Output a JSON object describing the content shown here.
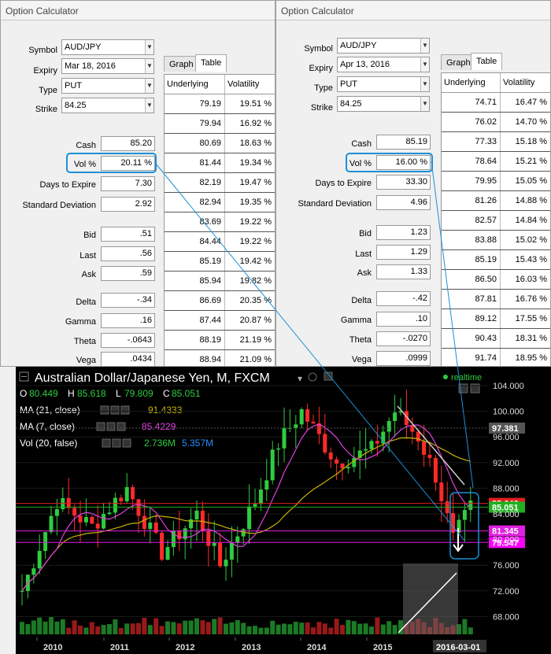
{
  "calc1": {
    "title": "Option Calculator",
    "symbol": "AUD/JPY",
    "expiry": "Mar 18, 2016",
    "type": "PUT",
    "strike": "84.25",
    "labels": {
      "symbol": "Symbol",
      "expiry": "Expiry",
      "type": "Type",
      "strike": "Strike",
      "cash": "Cash",
      "vol": "Vol %",
      "days": "Days to Expire",
      "std": "Standard Deviation",
      "bid": "Bid",
      "last": "Last",
      "ask": "Ask",
      "delta": "Delta",
      "gamma": "Gamma",
      "theta": "Theta",
      "vega": "Vega"
    },
    "cash": "85.20",
    "vol": "20.11 %",
    "days": "7.30",
    "std": "2.92",
    "bid": ".51",
    "last": ".56",
    "ask": ".59",
    "delta": "-.34",
    "gamma": ".16",
    "theta": "-.0643",
    "vega": ".0434",
    "tab_graph": "Graph",
    "tab_table": "Table",
    "col_underlying": "Underlying",
    "col_volatility": "Volatility",
    "rows": [
      [
        "79.19",
        "19.51 %"
      ],
      [
        "79.94",
        "16.92 %"
      ],
      [
        "80.69",
        "18.63 %"
      ],
      [
        "81.44",
        "19.34 %"
      ],
      [
        "82.19",
        "19.47 %"
      ],
      [
        "82.94",
        "19.35 %"
      ],
      [
        "83.69",
        "19.22 %"
      ],
      [
        "84.44",
        "19.22 %"
      ],
      [
        "85.19",
        "19.42 %"
      ],
      [
        "85.94",
        "19.82 %"
      ],
      [
        "86.69",
        "20.35 %"
      ],
      [
        "87.44",
        "20.87 %"
      ],
      [
        "88.19",
        "21.19 %"
      ],
      [
        "88.94",
        "21.09 %"
      ]
    ]
  },
  "calc2": {
    "title": "Option Calculator",
    "symbol": "AUD/JPY",
    "expiry": "Apr 13, 2016",
    "type": "PUT",
    "strike": "84.25",
    "labels": {
      "symbol": "Symbol",
      "expiry": "Expiry",
      "type": "Type",
      "strike": "Strike",
      "cash": "Cash",
      "vol": "Vol %",
      "days": "Days to Expire",
      "std": "Standard Deviation",
      "bid": "Bid",
      "last": "Last",
      "ask": "Ask",
      "delta": "Delta",
      "gamma": "Gamma",
      "theta": "Theta",
      "vega": "Vega"
    },
    "cash": "85.19",
    "vol": "16.00 %",
    "days": "33.30",
    "std": "4.96",
    "bid": "1.23",
    "last": "1.29",
    "ask": "1.33",
    "delta": "-.42",
    "gamma": ".10",
    "theta": "-.0270",
    "vega": ".0999",
    "tab_graph": "Graph",
    "tab_table": "Table",
    "col_underlying": "Underlying",
    "col_volatility": "Volatility",
    "rows": [
      [
        "74.71",
        "16.47 %"
      ],
      [
        "76.02",
        "14.70 %"
      ],
      [
        "77.33",
        "15.18 %"
      ],
      [
        "78.64",
        "15.21 %"
      ],
      [
        "79.95",
        "15.05 %"
      ],
      [
        "81.26",
        "14.88 %"
      ],
      [
        "82.57",
        "14.84 %"
      ],
      [
        "83.88",
        "15.02 %"
      ],
      [
        "85.19",
        "15.43 %"
      ],
      [
        "86.50",
        "16.03 %"
      ],
      [
        "87.81",
        "16.76 %"
      ],
      [
        "89.12",
        "17.55 %"
      ],
      [
        "90.43",
        "18.31 %"
      ],
      [
        "91.74",
        "18.95 %"
      ]
    ]
  },
  "chart": {
    "title": "Australian Dollar/Japanese Yen, M, FXCM",
    "realtime": "realtime",
    "o_label": "O",
    "o": "80.449",
    "h_label": "H",
    "h": "85.618",
    "l_label": "L",
    "l": "79.809",
    "c_label": "C",
    "c": "85.051",
    "ma21_label": "MA (21, close)",
    "ma21_val": "91.4333",
    "ma7_label": "MA (7, close)",
    "ma7_val": "85.4229",
    "vol_label": "Vol (20, false)",
    "vol_val1": "2.736M",
    "vol_val2": "5.357M",
    "colors": {
      "up": "#2ecc40",
      "down": "#ff2a2a",
      "ma21": "#c8b400",
      "ma7": "#e040e0",
      "vol1": "#2ecc40",
      "vol2": "#2a8cff"
    },
    "price_labels": [
      "104.000",
      "100.000",
      "96.000",
      "92.000",
      "88.000",
      "84.000",
      "80.000",
      "76.000",
      "72.000",
      "68.000"
    ],
    "tags": [
      {
        "text": "97.381",
        "color": "#555555"
      },
      {
        "text": "85.646",
        "color": "#e02020"
      },
      {
        "text": "85.051",
        "color": "#20b020"
      },
      {
        "text": "81.345",
        "color": "#e020e0"
      },
      {
        "text": "79.547",
        "color": "#ff00ff"
      }
    ],
    "years": [
      "2010",
      "2011",
      "2012",
      "2013",
      "2014",
      "2015"
    ],
    "date_tag": "2016-03-01"
  }
}
